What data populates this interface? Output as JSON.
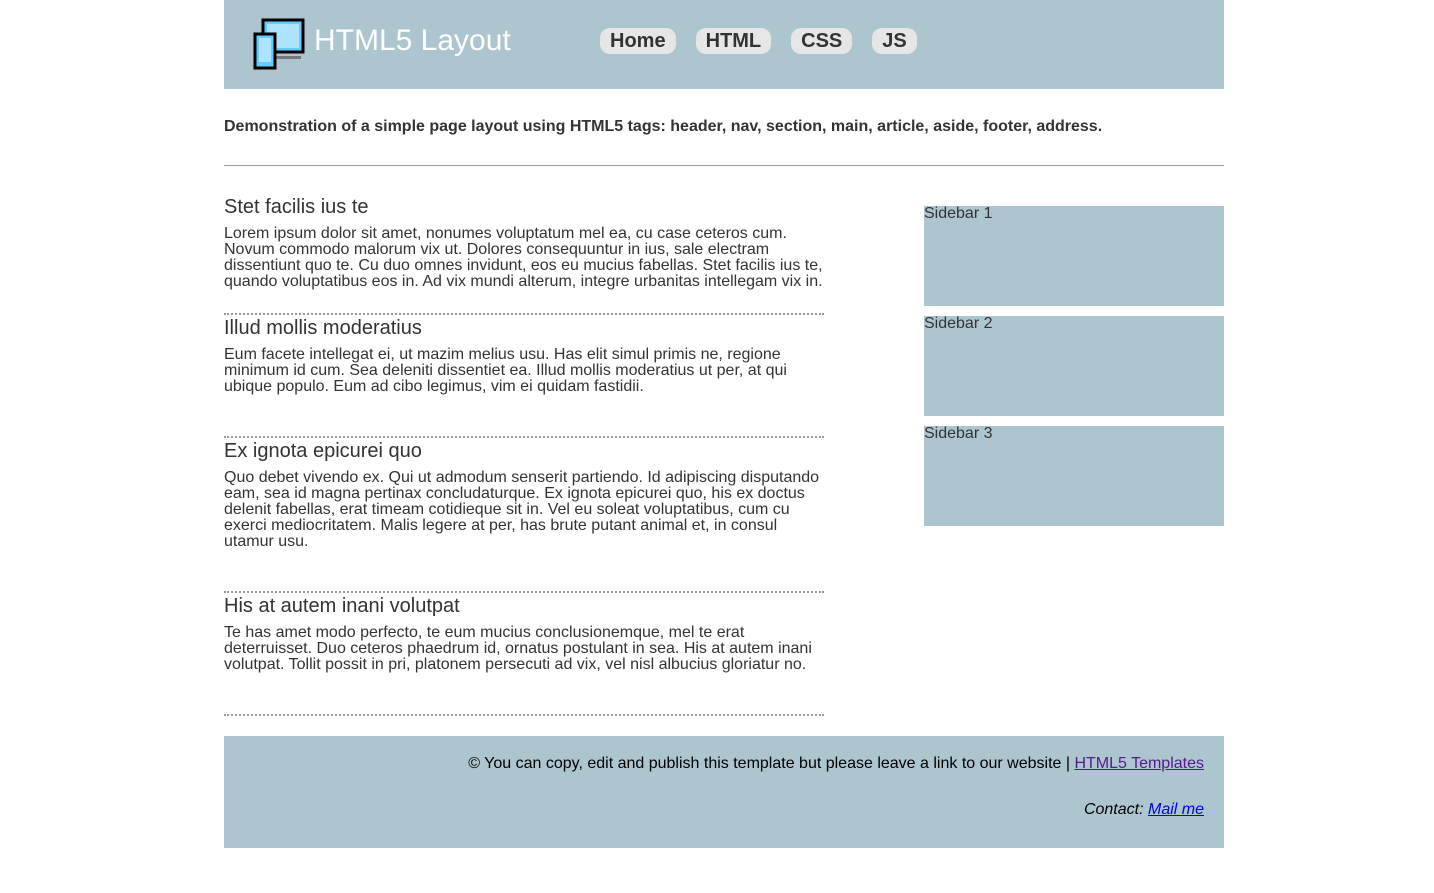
{
  "header": {
    "brand_title": "HTML5 Layout",
    "logo_icon": "devices-icon"
  },
  "nav": {
    "items": [
      {
        "label": "Home"
      },
      {
        "label": "HTML"
      },
      {
        "label": "CSS"
      },
      {
        "label": "JS"
      }
    ]
  },
  "intro": {
    "text": "Demonstration of a simple page layout using HTML5 tags: header, nav, section, main, article, aside, footer, address."
  },
  "articles": [
    {
      "title": "Stet facilis ius te",
      "body": "Lorem ipsum dolor sit amet, nonumes voluptatum mel ea, cu case ceteros cum. Novum commodo malorum vix ut. Dolores consequuntur in ius, sale electram dissentiunt quo te. Cu duo omnes invidunt, eos eu mucius fabellas. Stet facilis ius te, quando voluptatibus eos in. Ad vix mundi alterum, integre urbanitas intellegam vix in."
    },
    {
      "title": "Illud mollis moderatius",
      "body": "Eum facete intellegat ei, ut mazim melius usu. Has elit simul primis ne, regione minimum id cum. Sea deleniti dissentiet ea. Illud mollis moderatius ut per, at qui ubique populo. Eum ad cibo legimus, vim ei quidam fastidii."
    },
    {
      "title": "Ex ignota epicurei quo",
      "body": "Quo debet vivendo ex. Qui ut admodum senserit partiendo. Id adipiscing disputando eam, sea id magna pertinax concludaturque. Ex ignota epicurei quo, his ex doctus delenit fabellas, erat timeam cotidieque sit in. Vel eu soleat voluptatibus, cum cu exerci mediocritatem. Malis legere at per, has brute putant animal et, in consul utamur usu."
    },
    {
      "title": "His at autem inani volutpat",
      "body": "Te has amet modo perfecto, te eum mucius conclusionemque, mel te erat deterruisset. Duo ceteros phaedrum id, ornatus postulant in sea. His at autem inani volutpat. Tollit possit in pri, platonem persecuti ad vix, vel nisl albucius gloriatur no."
    }
  ],
  "sidebar": {
    "boxes": [
      {
        "label": "Sidebar 1"
      },
      {
        "label": "Sidebar 2"
      },
      {
        "label": "Sidebar 3"
      }
    ]
  },
  "footer": {
    "copy_text": "© You can copy, edit and publish this template but please leave a link to our website | ",
    "copy_link": "HTML5 Templates",
    "contact_label": "Contact: ",
    "contact_link": "Mail me"
  },
  "colors": {
    "header_bg": "#adc5cf",
    "nav_button_bg": "#e6e6e6",
    "visited_link": "#551a8b",
    "link": "#0000ee"
  }
}
